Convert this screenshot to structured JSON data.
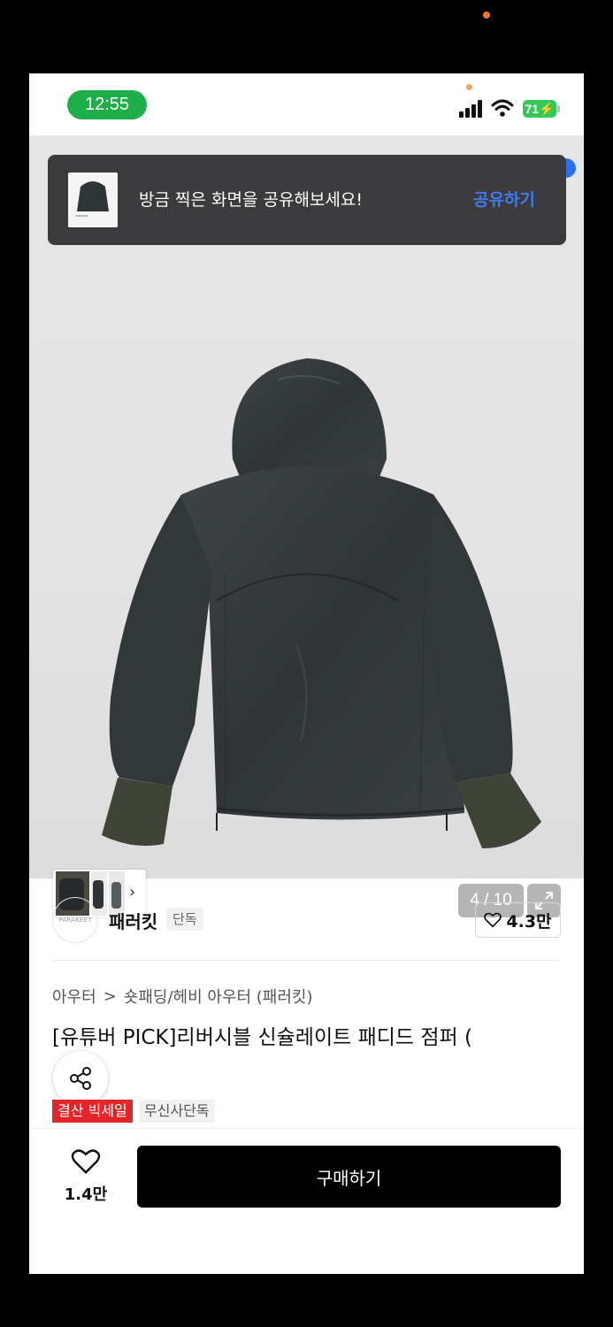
{
  "status_bar": {
    "time": "12:55",
    "battery": "71"
  },
  "toast": {
    "message": "방금 찍은 화면을 공유해보세요!",
    "action": "공유하기"
  },
  "gallery": {
    "counter": "4 / 10"
  },
  "brand": {
    "logo_text": "PARAKEET",
    "name": "패러킷",
    "tag": "단독",
    "likes": "4.3만"
  },
  "breadcrumb": {
    "level1": "아우터",
    "separator": ">",
    "level2": "숏패딩/헤비 아우터 (패러킷)"
  },
  "product": {
    "title": "[유튜버 PICK]리버시블 신슐레이트 패디드 점퍼 ("
  },
  "badges": {
    "sale": "결산 빅세일",
    "exclusive": "무신사단독"
  },
  "bottom": {
    "wish_count": "1.4만",
    "buy_label": "구매하기"
  },
  "colors": {
    "accent_blue": "#3d7bf0",
    "sale_red": "#e4262a",
    "status_green": "#1faf4a"
  }
}
